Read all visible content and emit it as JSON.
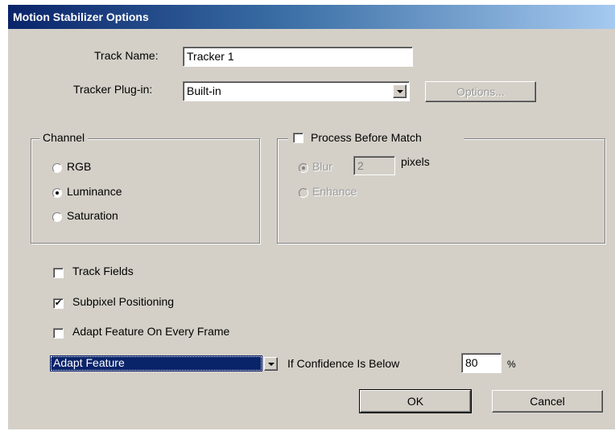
{
  "window": {
    "title": "Motion Stabilizer Options"
  },
  "track_name": {
    "label": "Track Name:",
    "value": "Tracker 1"
  },
  "tracker_plugin": {
    "label": "Tracker Plug-in:",
    "value": "Built-in",
    "options_button": "Options..."
  },
  "channel": {
    "legend": "Channel",
    "options": [
      {
        "label": "RGB",
        "checked": false
      },
      {
        "label": "Luminance",
        "checked": true
      },
      {
        "label": "Saturation",
        "checked": false
      }
    ]
  },
  "process_before_match": {
    "label": "Process Before Match",
    "checked": false,
    "blur": {
      "label": "Blur",
      "value": "2",
      "unit": "pixels",
      "checked": true
    },
    "enhance": {
      "label": "Enhance",
      "checked": false
    }
  },
  "checkboxes": {
    "track_fields": {
      "label": "Track Fields",
      "checked": false
    },
    "subpixel": {
      "label": "Subpixel Positioning",
      "checked": true
    },
    "adapt_every_frame": {
      "label": "Adapt Feature On Every Frame",
      "checked": false
    }
  },
  "adapt": {
    "selected": "Adapt Feature",
    "confidence_label": "If Confidence Is Below",
    "confidence_value": "80",
    "unit": "%"
  },
  "buttons": {
    "ok": "OK",
    "cancel": "Cancel"
  }
}
